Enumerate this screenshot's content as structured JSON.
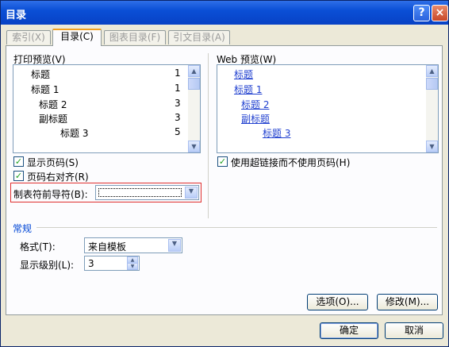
{
  "window": {
    "title": "目录"
  },
  "title_buttons": {
    "help": "?",
    "close": "×"
  },
  "tabs": [
    {
      "label": "索引(X)",
      "active": false
    },
    {
      "label": "目录(C)",
      "active": true
    },
    {
      "label": "图表目录(F)",
      "active": false
    },
    {
      "label": "引文目录(A)",
      "active": false
    }
  ],
  "print_preview": {
    "label": "打印预览(V)",
    "lines": [
      {
        "text": "标题",
        "page": "1"
      },
      {
        "text": "标题 1",
        "page": "1"
      },
      {
        "text": "标题 2",
        "page": "3"
      },
      {
        "text": "副标题",
        "page": "3"
      },
      {
        "text": "标题 3",
        "page": "5"
      }
    ]
  },
  "web_preview": {
    "label": "Web 预览(W)",
    "lines": [
      "标题",
      "标题 1",
      "标题 2",
      "副标题",
      "标题 3"
    ]
  },
  "options": {
    "show_page_numbers": {
      "label": "显示页码(S)",
      "checked": true
    },
    "right_align": {
      "label": "页码右对齐(R)",
      "checked": true
    },
    "use_hyperlinks": {
      "label": "使用超链接而不使用页码(H)",
      "checked": true
    }
  },
  "tab_leader": {
    "label": "制表符前导符(B):",
    "value": ""
  },
  "general": {
    "section_label": "常规",
    "format_label": "格式(T):",
    "format_value": "来自模板",
    "levels_label": "显示级别(L):",
    "levels_value": "3"
  },
  "buttons": {
    "options": "选项(O)...",
    "modify": "修改(M)...",
    "ok": "确定",
    "cancel": "取消"
  },
  "icons": {
    "dropdown": "chevron-down-icon",
    "scroll_up": "arrow-up-icon",
    "scroll_down": "arrow-down-icon",
    "check": "check-icon"
  }
}
